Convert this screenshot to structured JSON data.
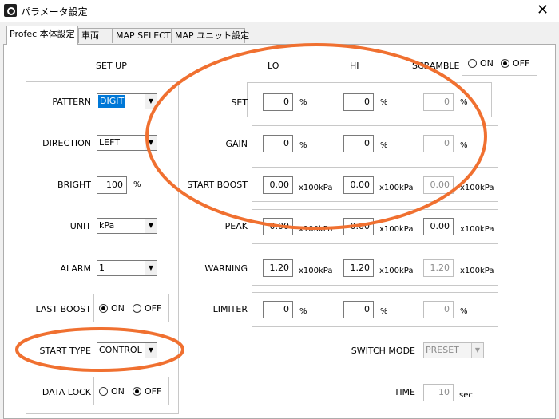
{
  "window": {
    "title": "パラメータ設定",
    "close_glyph": "✕"
  },
  "tabs": [
    {
      "label": "Profec 本体設定"
    },
    {
      "label": "車両"
    },
    {
      "label": "MAP SELECT"
    },
    {
      "label": "MAP ユニット設定"
    }
  ],
  "setup": {
    "heading": "SET UP",
    "pattern": {
      "label": "PATTERN",
      "value": "DIGIT"
    },
    "direction": {
      "label": "DIRECTION",
      "value": "LEFT"
    },
    "bright": {
      "label": "BRIGHT",
      "value": "100",
      "unit": "%"
    },
    "unit": {
      "label": "UNIT",
      "value": "kPa"
    },
    "alarm": {
      "label": "ALARM",
      "value": "1"
    },
    "last_boost": {
      "label": "LAST BOOST",
      "on": "ON",
      "off": "OFF",
      "selected": "ON"
    },
    "start_type": {
      "label": "START TYPE",
      "value": "CONTROL"
    },
    "data_lock": {
      "label": "DATA LOCK",
      "on": "ON",
      "off": "OFF",
      "selected": "OFF"
    }
  },
  "columns": {
    "lo": "LO",
    "hi": "HI",
    "scramble": "SCRAMBLE"
  },
  "scramble": {
    "on": "ON",
    "off": "OFF",
    "selected": "OFF"
  },
  "params": {
    "set": {
      "label": "SET",
      "lo": "0",
      "hi": "0",
      "scramble": "0",
      "unit": "%"
    },
    "gain": {
      "label": "GAIN",
      "lo": "0",
      "hi": "0",
      "scramble": "0",
      "unit": "%"
    },
    "start_boost": {
      "label": "START BOOST",
      "lo": "0.00",
      "hi": "0.00",
      "scramble": "0.00",
      "unit": "x100kPa"
    },
    "peak": {
      "label": "PEAK",
      "lo": "0.00",
      "hi": "0.00",
      "scramble": "0.00",
      "unit": "x100kPa"
    },
    "warning": {
      "label": "WARNING",
      "lo": "1.20",
      "hi": "1.20",
      "scramble": "1.20",
      "unit": "x100kPa"
    },
    "limiter": {
      "label": "LIMITER",
      "lo": "0",
      "hi": "0",
      "scramble": "0",
      "unit": "%"
    }
  },
  "switch_mode": {
    "label": "SWITCH MODE",
    "value": "PRESET"
  },
  "time": {
    "label": "TIME",
    "value": "10",
    "unit": "sec"
  },
  "colors": {
    "highlight_ellipse": "#f07030",
    "selection_blue": "#0078d7"
  }
}
